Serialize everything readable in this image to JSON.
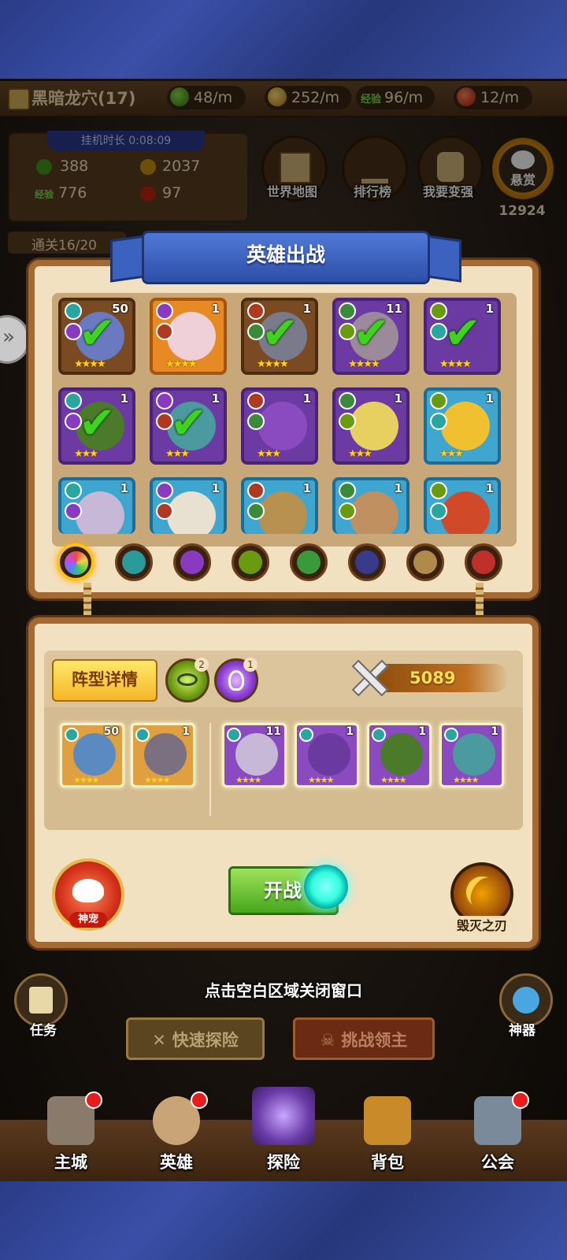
{
  "colors": {
    "accent_blue": "#2d4fa8",
    "panel": "#f2e1c0",
    "frame": "#a56a31",
    "start_green": "#47a61c",
    "power_text": "#ffe05a"
  },
  "header": {
    "location": "黑暗龙穴(17)",
    "rates": [
      {
        "icon": "potion-icon",
        "value": "48/m"
      },
      {
        "icon": "gold-coin-icon",
        "value": "252/m"
      },
      {
        "icon": "exp-icon",
        "value": "96/m",
        "prefix": "经验"
      },
      {
        "icon": "fire-gem-icon",
        "value": "12/m"
      }
    ]
  },
  "idle": {
    "time_label": "挂机时长 0:08:09",
    "potion": "388",
    "gold": "2037",
    "exp_prefix": "经验",
    "exp": "776",
    "gem": "97"
  },
  "top_buttons": [
    {
      "label": "世界地图",
      "icon": "world-map-icon"
    },
    {
      "label": "排行榜",
      "icon": "leaderboard-icon"
    },
    {
      "label": "我要变强",
      "icon": "fist-icon"
    },
    {
      "label": "悬赏",
      "icon": "bounty-icon",
      "count": "12924"
    }
  ],
  "stage_progress": "通关16/20",
  "hero_select": {
    "title": "英雄出战",
    "heroes": [
      {
        "level": "50",
        "stars": "★★★★",
        "selected": true,
        "frame": "brown"
      },
      {
        "level": "1",
        "stars": "★★★★",
        "selected": false,
        "frame": "orange"
      },
      {
        "level": "1",
        "stars": "★★★★",
        "selected": true,
        "frame": "brown"
      },
      {
        "level": "11",
        "stars": "★★★★",
        "selected": true,
        "frame": "purple"
      },
      {
        "level": "1",
        "stars": "★★★★",
        "selected": true,
        "frame": "purple"
      },
      {
        "level": "1",
        "stars": "★★★",
        "selected": true,
        "frame": "purple"
      },
      {
        "level": "1",
        "stars": "★★★",
        "selected": true,
        "frame": "purple"
      },
      {
        "level": "1",
        "stars": "★★★",
        "selected": false,
        "frame": "purple"
      },
      {
        "level": "1",
        "stars": "★★★",
        "selected": false,
        "frame": "purple"
      },
      {
        "level": "1",
        "stars": "★★★",
        "selected": false,
        "frame": "blue"
      },
      {
        "level": "1",
        "stars": "★★★",
        "selected": false,
        "frame": "blue"
      },
      {
        "level": "1",
        "stars": "★★★",
        "selected": false,
        "frame": "blue"
      },
      {
        "level": "1",
        "stars": "★★★",
        "selected": false,
        "frame": "blue"
      },
      {
        "level": "1",
        "stars": "★★★",
        "selected": false,
        "frame": "blue"
      },
      {
        "level": "1",
        "stars": "★★★",
        "selected": false,
        "frame": "blue"
      }
    ],
    "filters": [
      {
        "icon": "all-factions-icon",
        "active": true
      },
      {
        "icon": "water-faction-icon",
        "active": false
      },
      {
        "icon": "arcane-faction-icon",
        "active": false
      },
      {
        "icon": "eye-faction-icon",
        "active": false
      },
      {
        "icon": "nature-faction-icon",
        "active": false
      },
      {
        "icon": "dark-faction-icon",
        "active": false
      },
      {
        "icon": "light-faction-icon",
        "active": false
      },
      {
        "icon": "fire-faction-icon",
        "active": false
      }
    ]
  },
  "formation": {
    "details_label": "阵型详情",
    "bonus1": "2",
    "bonus2": "1",
    "power": "5089",
    "front": [
      {
        "level": "50",
        "stars": "★★★★"
      },
      {
        "level": "1",
        "stars": "★★★★"
      }
    ],
    "back": [
      {
        "level": "11",
        "stars": "★★★★"
      },
      {
        "level": "1",
        "stars": "★★★★"
      },
      {
        "level": "1",
        "stars": "★★★★"
      },
      {
        "level": "1",
        "stars": "★★★★"
      }
    ],
    "start_label": "开战",
    "pet_label": "神宠",
    "skill_label": "毁灭之刃"
  },
  "hint": "点击空白区域关闭窗口",
  "side": {
    "quest": "任务",
    "artifact": "神器"
  },
  "actions": {
    "quick_explore": "快速探险",
    "challenge_boss": "挑战领主"
  },
  "nav": [
    {
      "label": "主城",
      "icon": "castle-icon"
    },
    {
      "label": "英雄",
      "icon": "hero-icon"
    },
    {
      "label": "探险",
      "icon": "portal-icon"
    },
    {
      "label": "背包",
      "icon": "backpack-icon"
    },
    {
      "label": "公会",
      "icon": "guild-icon"
    }
  ]
}
